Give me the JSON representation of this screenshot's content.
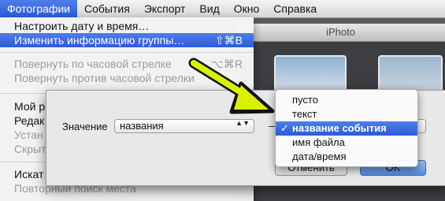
{
  "menubar": {
    "items": [
      {
        "label": "Фотографии",
        "active": true
      },
      {
        "label": "События",
        "active": false
      },
      {
        "label": "Экспорт",
        "active": false
      },
      {
        "label": "Вид",
        "active": false
      },
      {
        "label": "Окно",
        "active": false
      },
      {
        "label": "Справка",
        "active": false
      }
    ]
  },
  "window": {
    "title": "iPhoto"
  },
  "menu": {
    "items": [
      {
        "label": "Настроить дату и время…",
        "shortcut": "",
        "state": "enabled"
      },
      {
        "label": "Изменить информацию группы…",
        "shortcut": "⇧⌘B",
        "state": "highlighted"
      },
      {
        "label": "Повернуть по часовой стрелке",
        "shortcut": "⌥⌘R",
        "state": "disabled"
      },
      {
        "label": "Повернуть против часовой стрелки",
        "shortcut": "",
        "state": "disabled"
      },
      {
        "label": "Мой р",
        "shortcut": "",
        "state": "enabled"
      },
      {
        "label": "Редак",
        "shortcut": "",
        "state": "enabled"
      },
      {
        "label": "Устан",
        "shortcut": "",
        "state": "disabled"
      },
      {
        "label": "Скрыт",
        "shortcut": "",
        "state": "disabled"
      },
      {
        "label": "Искат",
        "shortcut": "",
        "state": "enabled"
      },
      {
        "label": "Повторный поиск места",
        "shortcut": "",
        "state": "disabled"
      }
    ]
  },
  "dialog": {
    "field_label": "Значение",
    "popup_value": "названия",
    "popup_arrows": "▲▼",
    "cancel_label": "Отменить",
    "ok_label": "OK"
  },
  "options": {
    "items": [
      {
        "label": "пусто",
        "selected": false
      },
      {
        "label": "текст",
        "selected": false
      },
      {
        "label": "название события",
        "selected": true
      },
      {
        "label": "имя файла",
        "selected": false
      },
      {
        "label": "дата/время",
        "selected": false
      }
    ],
    "checkmark": "✓"
  },
  "colors": {
    "menu_highlight": "#2b5ddb",
    "annotation_arrow": "#d9f000"
  }
}
